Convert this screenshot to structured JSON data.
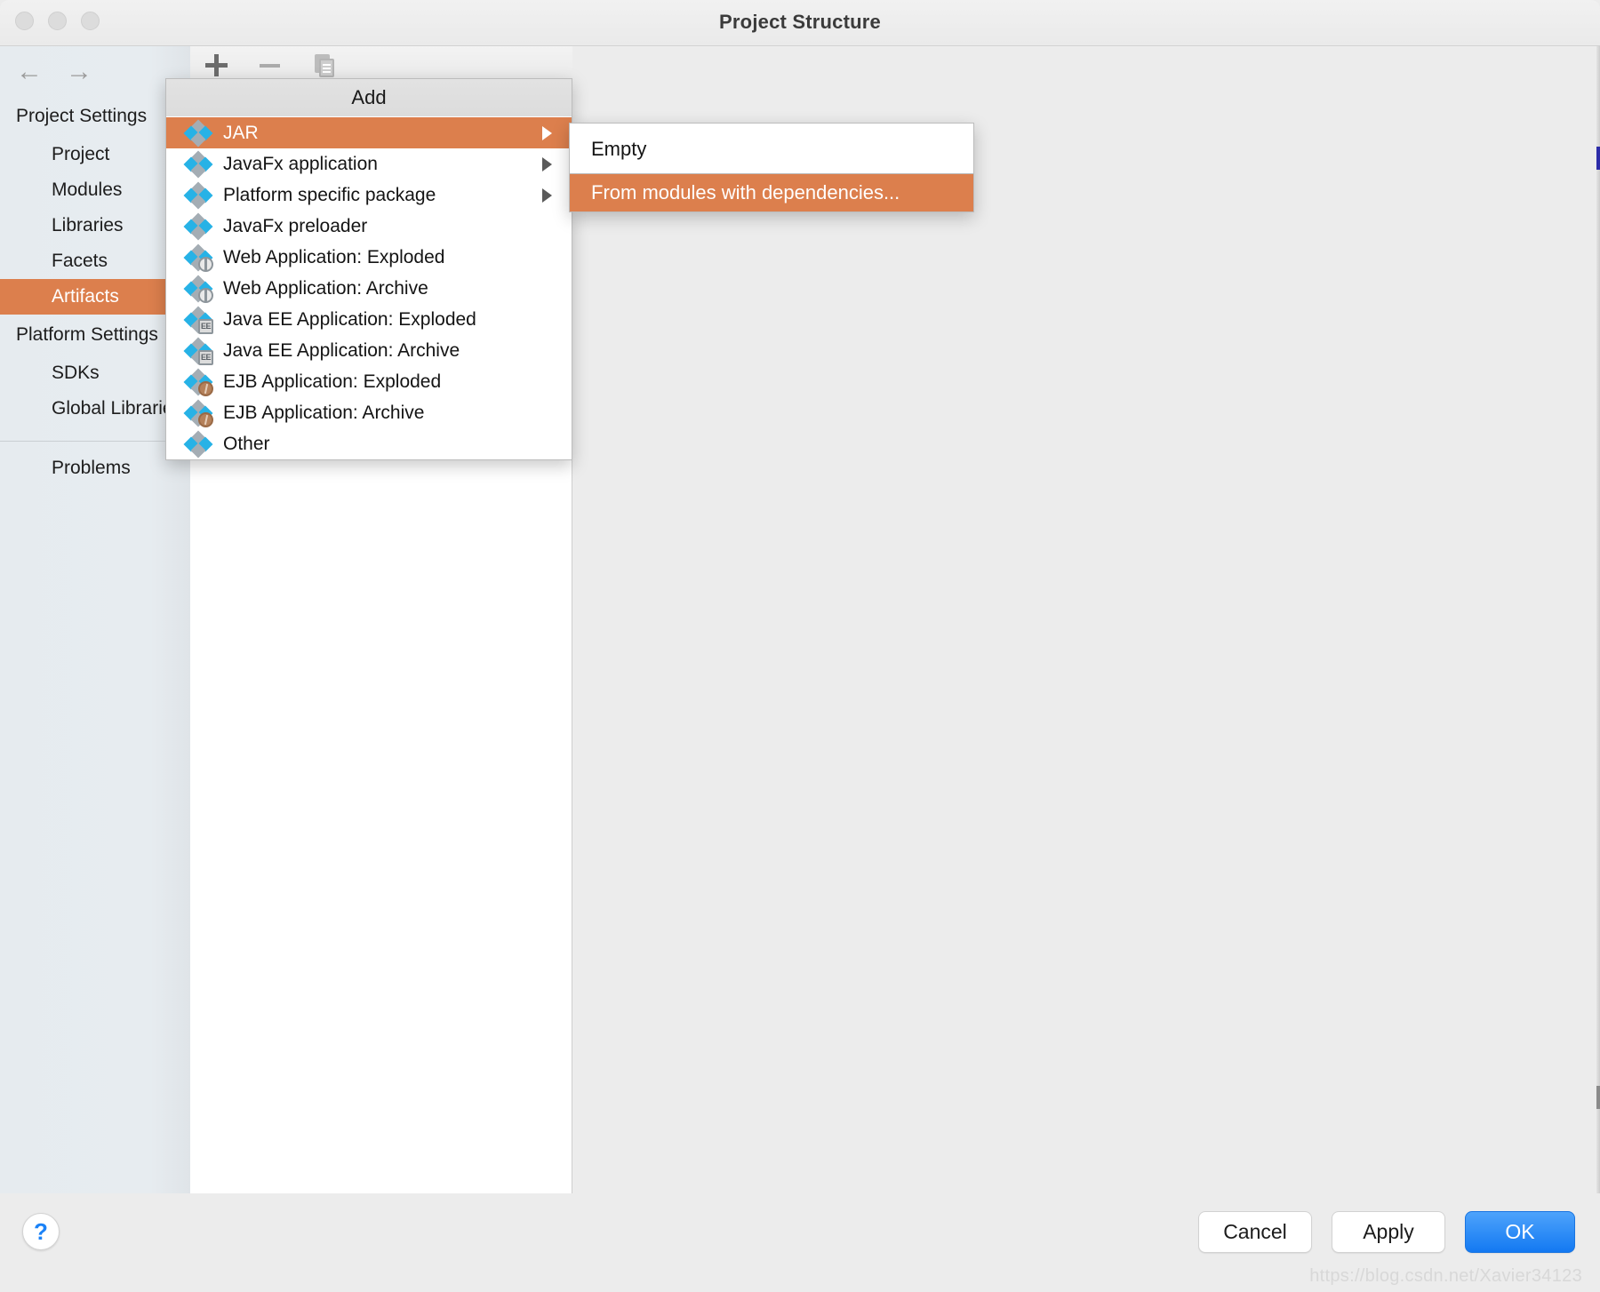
{
  "window": {
    "title": "Project Structure",
    "traffic_lights": [
      "close-button",
      "minimize-button",
      "zoom-button"
    ]
  },
  "sidebar": {
    "nav": {
      "back": "←",
      "forward": "→"
    },
    "groups": [
      {
        "label": "Project Settings",
        "items": [
          {
            "label": "Project",
            "selected": false
          },
          {
            "label": "Modules",
            "selected": false
          },
          {
            "label": "Libraries",
            "selected": false
          },
          {
            "label": "Facets",
            "selected": false
          },
          {
            "label": "Artifacts",
            "selected": true
          }
        ]
      },
      {
        "label": "Platform Settings",
        "items": [
          {
            "label": "SDKs",
            "selected": false
          },
          {
            "label": "Global Libraries",
            "selected": false
          }
        ]
      }
    ],
    "footer_item": {
      "label": "Problems",
      "selected": false
    }
  },
  "toolbar": {
    "add_label": "+",
    "remove_label": "−",
    "copy_label": "Copy"
  },
  "popup_menu": {
    "header": "Add",
    "items": [
      {
        "label": "JAR",
        "icon": "diamond-cluster-icon",
        "badge": "none",
        "submenu": true,
        "highlight": true
      },
      {
        "label": "JavaFx application",
        "icon": "diamond-cluster-icon",
        "badge": "none",
        "submenu": true,
        "highlight": false
      },
      {
        "label": "Platform specific package",
        "icon": "diamond-cluster-icon",
        "badge": "none",
        "submenu": true,
        "highlight": false
      },
      {
        "label": "JavaFx preloader",
        "icon": "diamond-cluster-icon",
        "badge": "none",
        "submenu": false,
        "highlight": false
      },
      {
        "label": "Web Application: Exploded",
        "icon": "diamond-cluster-icon",
        "badge": "globe",
        "submenu": false,
        "highlight": false
      },
      {
        "label": "Web Application: Archive",
        "icon": "diamond-cluster-icon",
        "badge": "globe",
        "submenu": false,
        "highlight": false
      },
      {
        "label": "Java EE Application: Exploded",
        "icon": "diamond-cluster-icon",
        "badge": "ee",
        "submenu": false,
        "highlight": false
      },
      {
        "label": "Java EE Application: Archive",
        "icon": "diamond-cluster-icon",
        "badge": "ee",
        "submenu": false,
        "highlight": false
      },
      {
        "label": "EJB Application: Exploded",
        "icon": "diamond-cluster-icon",
        "badge": "bean",
        "submenu": false,
        "highlight": false
      },
      {
        "label": "EJB Application: Archive",
        "icon": "diamond-cluster-icon",
        "badge": "bean",
        "submenu": false,
        "highlight": false
      },
      {
        "label": "Other",
        "icon": "diamond-cluster-icon",
        "badge": "none",
        "submenu": false,
        "highlight": false
      }
    ]
  },
  "submenu": {
    "items": [
      {
        "label": "Empty",
        "highlight": false
      },
      {
        "label": "From modules with dependencies...",
        "highlight": true
      }
    ]
  },
  "bottom": {
    "help_label": "?",
    "buttons": [
      {
        "label": "Cancel",
        "primary": false
      },
      {
        "label": "Apply",
        "primary": false
      },
      {
        "label": "OK",
        "primary": true
      }
    ]
  },
  "watermark": "https://blog.csdn.net/Xavier34123",
  "colors": {
    "accent_orange": "#dc7f4d",
    "primary_blue": "#1379f2",
    "icon_blue": "#27b2e6",
    "icon_gray": "#a4adb4",
    "sidebar_bg": "#e7ecf0",
    "panel_bg": "#ececec"
  },
  "badge_labels": {
    "ee": "EE"
  }
}
